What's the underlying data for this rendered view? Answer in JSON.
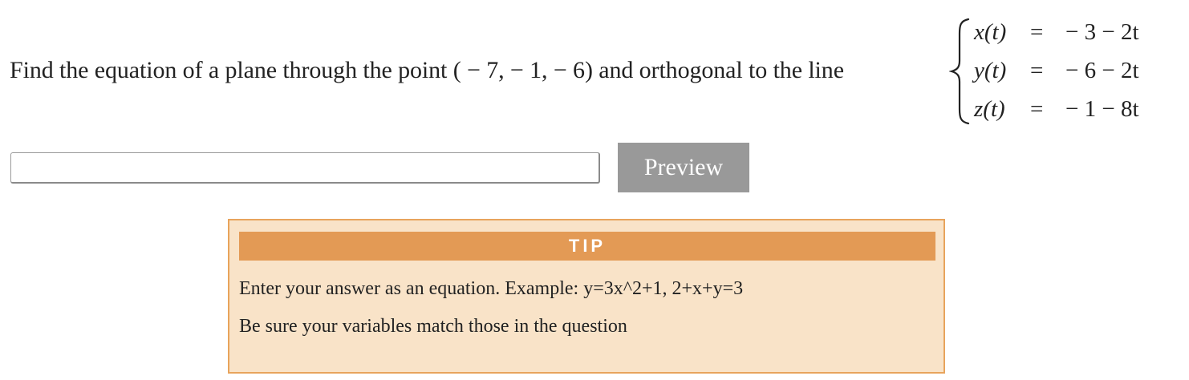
{
  "question": {
    "text_before": "Find the equation of a plane through the point ",
    "point": "( − 7,  − 1,  − 6)",
    "text_after": " and orthogonal to the line",
    "system": [
      {
        "lhs": "x(t)",
        "eq": "=",
        "rhs": "− 3 − 2t"
      },
      {
        "lhs": "y(t)",
        "eq": "=",
        "rhs": "− 6 − 2t"
      },
      {
        "lhs": "z(t)",
        "eq": "=",
        "rhs": "− 1 − 8t"
      }
    ]
  },
  "answer": {
    "value": "",
    "placeholder": ""
  },
  "preview_button": {
    "label": "Preview"
  },
  "tip": {
    "title": "TIP",
    "line1": "Enter your answer as an equation. Example: y=3x^2+1, 2+x+y=3",
    "line2": "Be sure your variables match those in the question"
  },
  "colors": {
    "tip_background": "#f9e3c8",
    "tip_border": "#e8a45c",
    "tip_header": "#e39a55",
    "button": "#999999"
  }
}
